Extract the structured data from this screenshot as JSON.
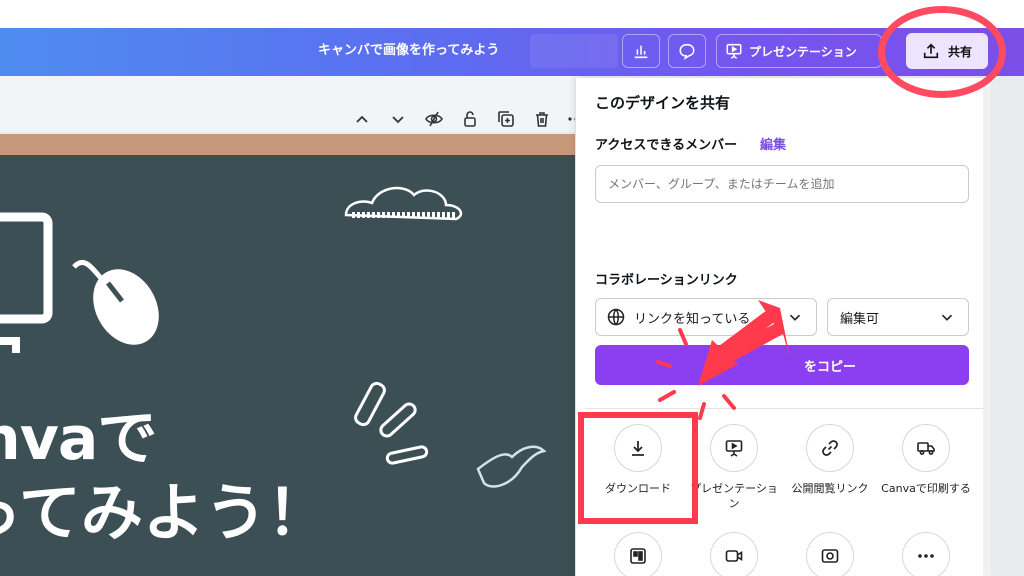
{
  "topbar": {
    "design_title": "キャンバで画像を作ってみよう",
    "present_label": "プレゼンテーション",
    "share_label": "共有"
  },
  "board": {
    "line1": "nvaで",
    "line2": "ってみよう！"
  },
  "share_panel": {
    "title": "このデザインを共有",
    "access_label": "アクセスできるメンバー",
    "access_edit_link": "編集",
    "member_input_placeholder": "メンバー、グループ、またはチームを追加",
    "collab_label": "コラボレーションリンク",
    "link_scope_value": "リンクを知っている",
    "permission_value": "編集可",
    "copy_button_label": "をコピー",
    "options": [
      {
        "label": "ダウンロード",
        "icon": "download-icon"
      },
      {
        "label": "プレゼンテーション",
        "icon": "presentation-icon"
      },
      {
        "label": "公開閲覧リンク",
        "icon": "link-icon"
      },
      {
        "label": "Canvaで印刷する",
        "icon": "truck-icon"
      }
    ],
    "more_options_icons": [
      "template-icon",
      "video-icon",
      "embed-icon",
      "more-icon"
    ]
  },
  "colors": {
    "accent": "#8b3ff0",
    "highlight": "#ff3a4c",
    "board": "#3c4f55"
  }
}
